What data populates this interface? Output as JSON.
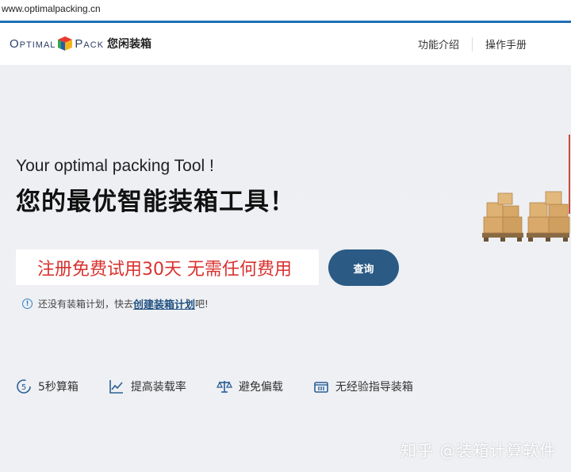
{
  "browser": {
    "url": "www.optimalpacking.cn"
  },
  "header": {
    "logo_left": "Optimal",
    "logo_right": "Pack",
    "logo_cn": "您闲装箱",
    "nav": [
      {
        "label": "功能介绍"
      },
      {
        "label": "操作手册"
      }
    ]
  },
  "hero": {
    "subtitle": "Your optimal packing Tool !",
    "title": "您的最优智能装箱工具！",
    "promo": "注册免费试用30天   无需任何费用",
    "query_label": "查询",
    "hint_prefix": "还没有装箱计划，快去",
    "hint_link": "创建装箱计划",
    "hint_suffix": "吧!"
  },
  "features": [
    {
      "label": "5秒算箱",
      "icon": "timer-5-icon"
    },
    {
      "label": "提高装载率",
      "icon": "line-chart-icon"
    },
    {
      "label": "避免偏载",
      "icon": "balance-scale-icon"
    },
    {
      "label": "无经验指导装箱",
      "icon": "container-icon"
    }
  ],
  "watermark": "知乎 @装箱计算软件",
  "colors": {
    "accent": "#1f6fb5",
    "button": "#2b5a85",
    "promo_text": "#d8322e",
    "link": "#1f4f80"
  }
}
